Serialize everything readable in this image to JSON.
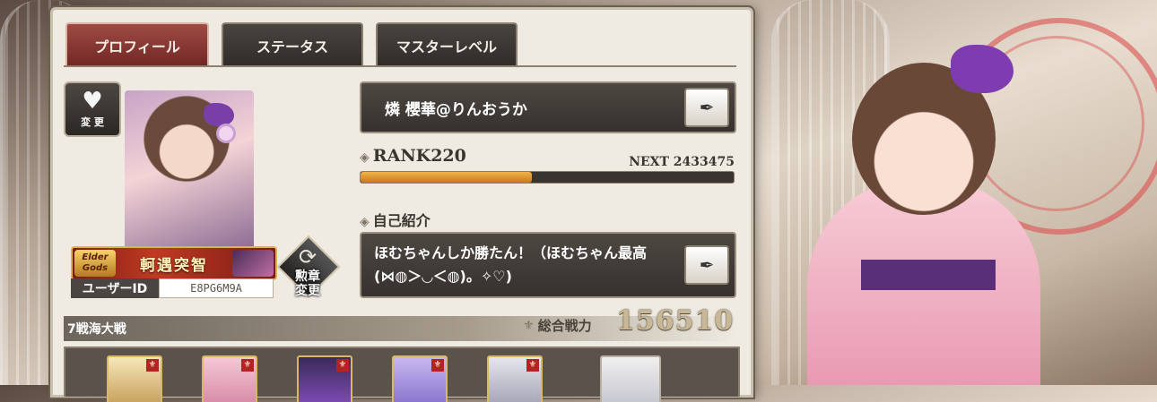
{
  "tabs": [
    {
      "label": "プロフィール",
      "active": true
    },
    {
      "label": "ステータス",
      "active": false
    },
    {
      "label": "マスターレベル",
      "active": false
    }
  ],
  "favorite": {
    "label": "変 更",
    "icon": "heart-icon"
  },
  "title_badge": {
    "logo_text": "Elder Gods",
    "title": "軻遇突智"
  },
  "user": {
    "id_label": "ユーザーID",
    "id_value": "E8PG6M9A"
  },
  "medal_button": {
    "label_line1": "勲章",
    "label_line2": "変更"
  },
  "profile": {
    "name": "燐 櫻華@りんおうか",
    "rank": "RANK220",
    "next": "NEXT 2433475",
    "exp_progress": 0.46,
    "intro_label": "自己紹介",
    "intro_text": "ほむちゃんしか勝たん！（ほむちゃん最高(⋈◍＞◡＜◍)。✧♡)"
  },
  "deck": {
    "name": "7戦海大戦",
    "power_label": "総合戦力",
    "power_value": "156510"
  },
  "colors": {
    "tab_active": "#8a3530",
    "panel_bg": "#efebe2",
    "exp_fill": "#e29a34"
  }
}
